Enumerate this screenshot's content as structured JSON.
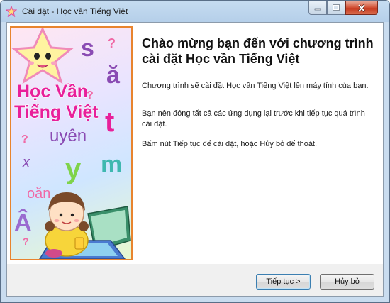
{
  "window": {
    "title": "Cài đặt - Học vần Tiếng Việt"
  },
  "banner": {
    "logo_line1": "Học Vần",
    "logo_line2": "Tiếng Việt",
    "letters": {
      "s": "s",
      "a_breve": "ă",
      "t": "t",
      "uyen": "uyên",
      "y": "y",
      "m": "m",
      "x": "x",
      "oan": "oăn",
      "a_hat": "Â",
      "q1": "?",
      "q2": "?",
      "q3": "?",
      "q4": "?"
    }
  },
  "content": {
    "heading": "Chào mừng bạn đến với chương trình cài đặt Học vần Tiếng Việt",
    "para1": "Chương trình sẽ cài đặt Học vần Tiếng Việt lên máy tính của bạn.",
    "para2": "Bạn nên đóng tất cả các ứng dụng lại trước khi tiếp tục quá trình cài đặt.",
    "para3": "Bấm nút Tiếp tục để cài đặt, hoặc Hủy bỏ để thoát."
  },
  "buttons": {
    "next": "Tiếp tục >",
    "cancel": "Hủy bỏ"
  },
  "colors": {
    "banner_border": "#e8842e",
    "logo_pink": "#e8209a",
    "letter_purple": "#8a4bb3",
    "letter_pink": "#f06aa6",
    "letter_teal": "#3fb8b0",
    "letter_green": "#7fd34a"
  }
}
